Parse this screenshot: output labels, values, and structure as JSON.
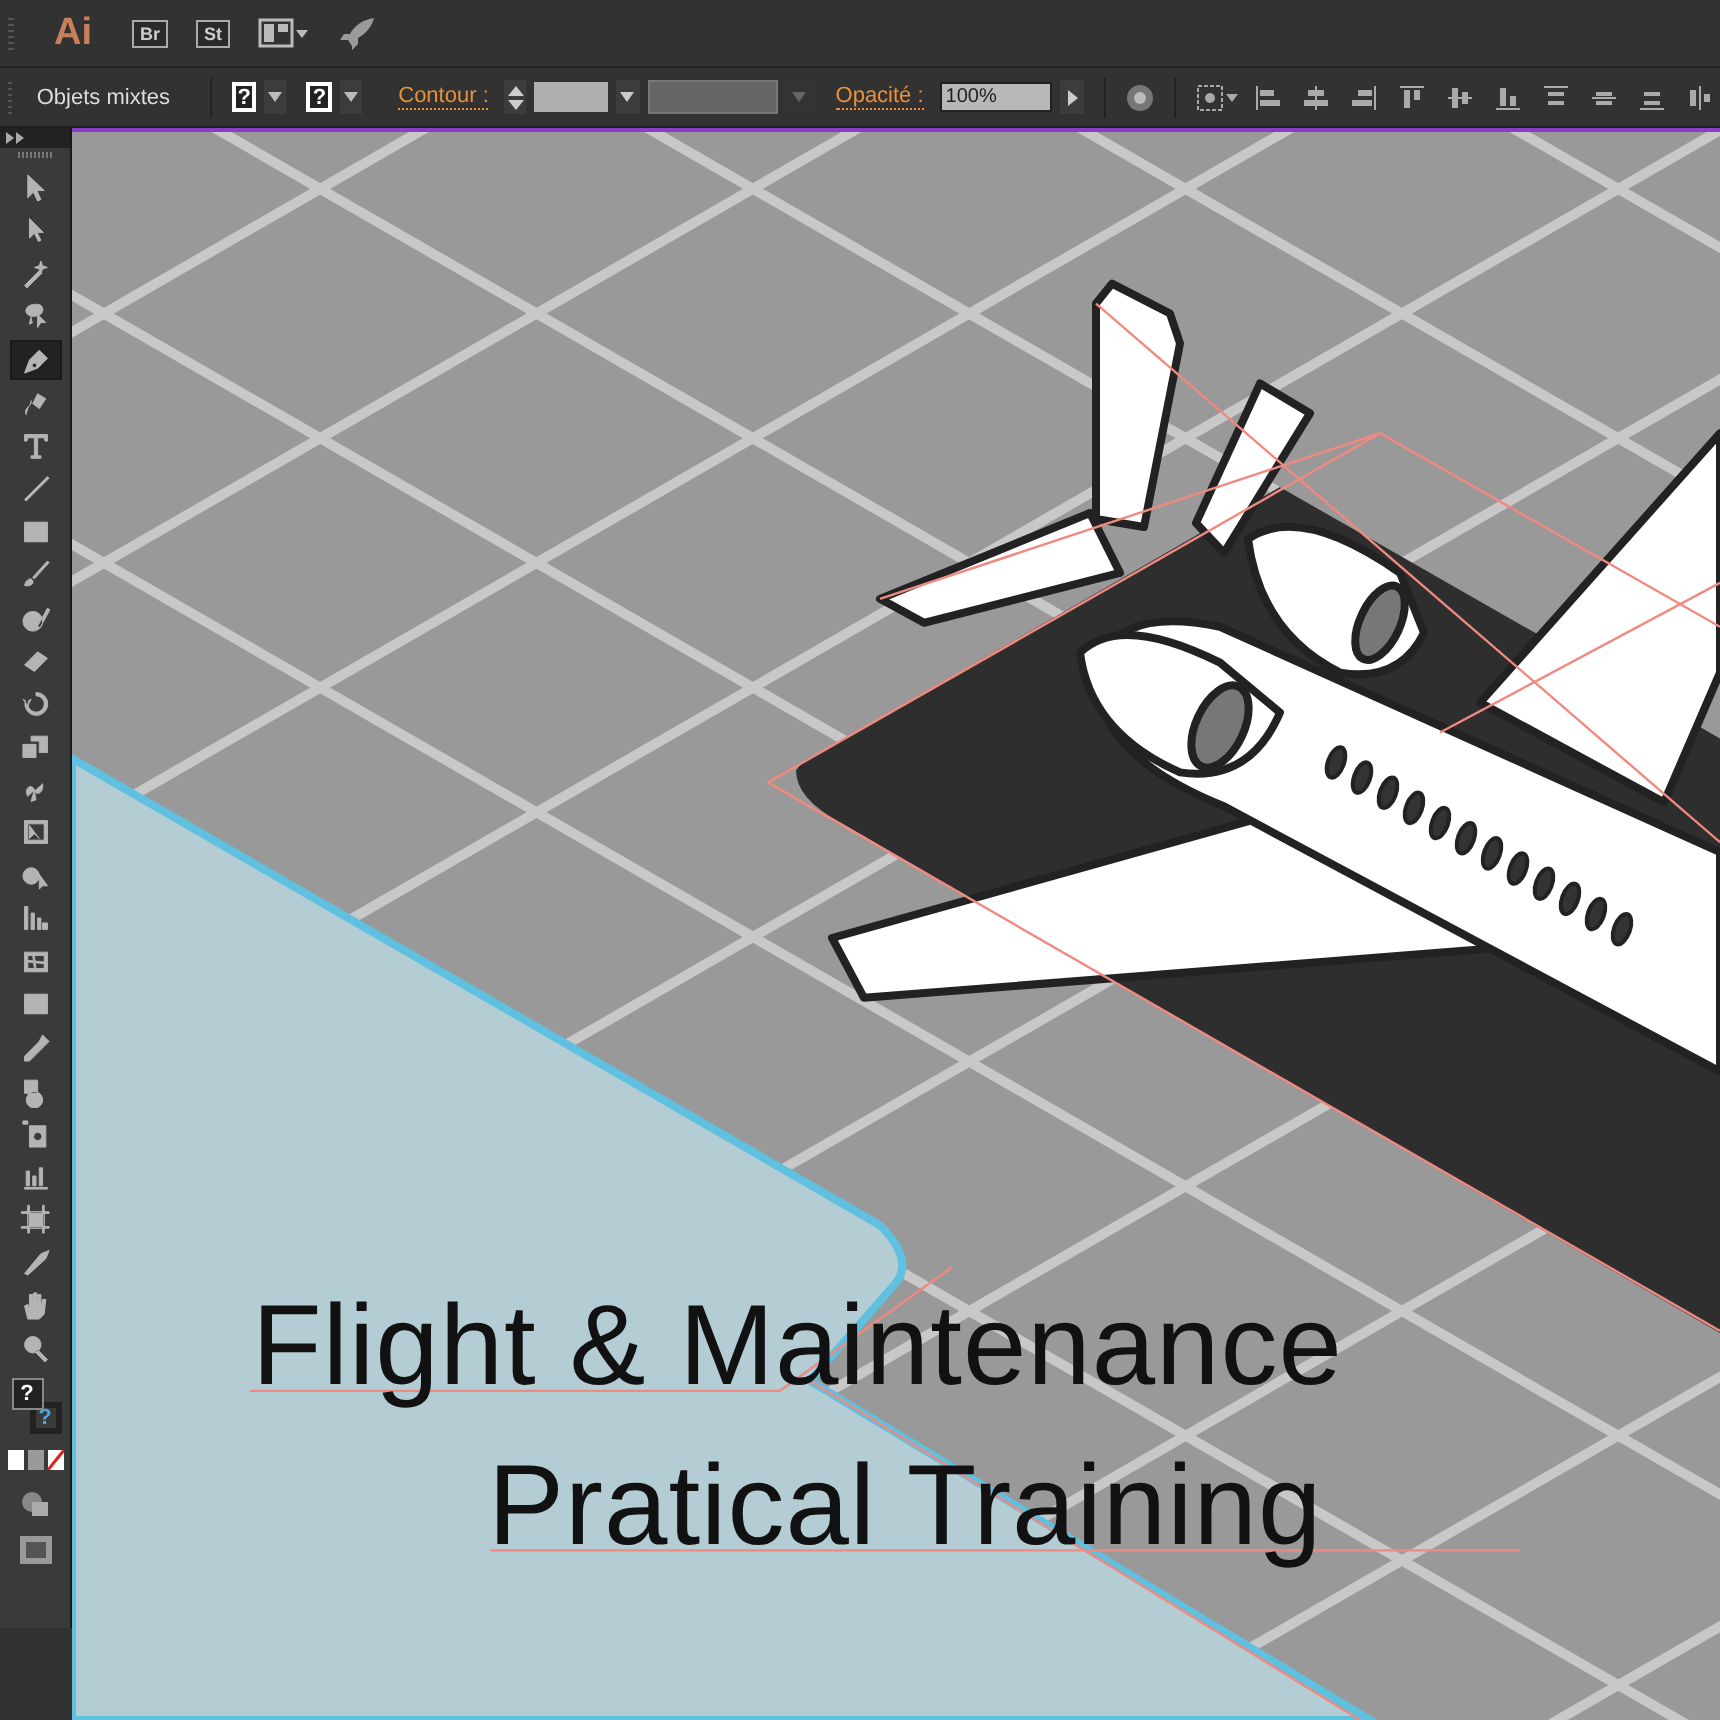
{
  "app_bar": {
    "logo": "Ai",
    "apps": [
      "Br",
      "St"
    ]
  },
  "control_bar": {
    "selection_label": "Objets mixtes",
    "fill_swatch": "?",
    "stroke_swatch": "?",
    "stroke_label": "Contour :",
    "opacity_label": "Opacité :",
    "opacity_value": "100%"
  },
  "tools": [
    {
      "kind": "selection",
      "selected": false
    },
    {
      "kind": "direct-selection",
      "selected": false
    },
    {
      "kind": "magic-wand",
      "selected": false
    },
    {
      "kind": "lasso",
      "selected": false
    },
    {
      "kind": "pen",
      "selected": true
    },
    {
      "kind": "curvature",
      "selected": false
    },
    {
      "kind": "type",
      "selected": false
    },
    {
      "kind": "line",
      "selected": false
    },
    {
      "kind": "rectangle",
      "selected": false
    },
    {
      "kind": "paintbrush",
      "selected": false
    },
    {
      "kind": "blob-brush",
      "selected": false
    },
    {
      "kind": "eraser",
      "selected": false
    },
    {
      "kind": "rotate",
      "selected": false
    },
    {
      "kind": "scale",
      "selected": false
    },
    {
      "kind": "warp",
      "selected": false
    },
    {
      "kind": "free-transform",
      "selected": false
    },
    {
      "kind": "shape-builder",
      "selected": false
    },
    {
      "kind": "perspective",
      "selected": false
    },
    {
      "kind": "mesh",
      "selected": false
    },
    {
      "kind": "gradient",
      "selected": false
    },
    {
      "kind": "eyedropper",
      "selected": false
    },
    {
      "kind": "blend",
      "selected": false
    },
    {
      "kind": "symbol-sprayer",
      "selected": false
    },
    {
      "kind": "graph",
      "selected": false
    },
    {
      "kind": "artboard",
      "selected": false
    },
    {
      "kind": "slice",
      "selected": false
    },
    {
      "kind": "hand",
      "selected": false
    },
    {
      "kind": "zoom",
      "selected": false
    }
  ],
  "fill_stroke": {
    "fill": "?",
    "stroke": "?"
  },
  "artboard": {
    "title_lines": [
      "Flight & Maintenance",
      "Pratical Training"
    ]
  }
}
